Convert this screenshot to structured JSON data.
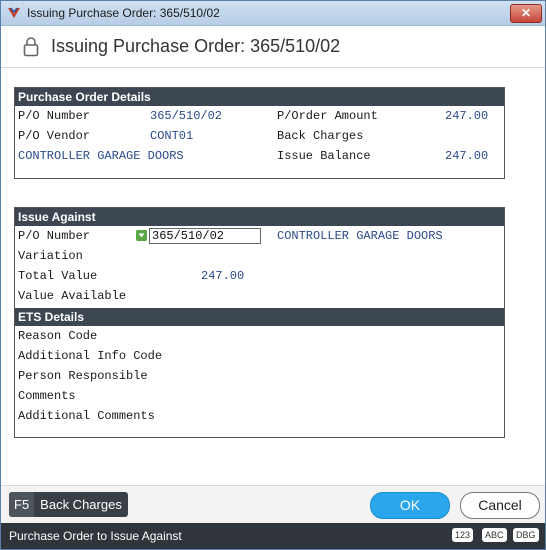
{
  "window": {
    "title": "Issuing Purchase Order: 365/510/02",
    "close_label": "✕"
  },
  "header": {
    "title": "Issuing Purchase Order: 365/510/02"
  },
  "po_details": {
    "heading": "Purchase Order Details",
    "po_number_label": "P/O Number",
    "po_number_value": "365/510/02",
    "po_vendor_label": "P/O Vendor",
    "po_vendor_value": "CONT01",
    "vendor_name": "CONTROLLER GARAGE DOORS",
    "order_amount_label": "P/Order Amount",
    "order_amount_value": "247.00",
    "back_charges_label": "Back Charges",
    "issue_balance_label": "Issue Balance",
    "issue_balance_value": "247.00"
  },
  "issue_against": {
    "heading": "Issue Against",
    "po_number_label": "P/O Number",
    "po_number_input": "365/510/02",
    "vendor_name": "CONTROLLER GARAGE DOORS",
    "variation_label": "Variation",
    "total_value_label": "Total Value",
    "total_value_value": "247.00",
    "value_available_label": "Value Available"
  },
  "ets": {
    "heading": "ETS Details",
    "reason_code_label": "Reason Code",
    "additional_info_label": "Additional Info Code",
    "person_responsible_label": "Person Responsible",
    "comments_label": "Comments",
    "additional_comments_label": "Additional Comments"
  },
  "footer": {
    "fkey_key": "F5",
    "fkey_label": "Back Charges",
    "ok_label": "OK",
    "cancel_label": "Cancel"
  },
  "status": {
    "text": "Purchase Order to Issue Against",
    "badges": [
      "123",
      "ABC",
      "DBG"
    ]
  },
  "colors": {
    "accent": "#2aa7ec",
    "panel_header": "#3d4752",
    "value_text": "#2a4a8a"
  }
}
